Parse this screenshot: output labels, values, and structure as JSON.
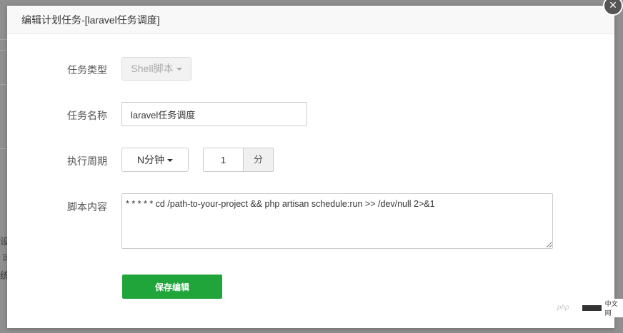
{
  "dialog": {
    "title": "编辑计划任务-[laravel任务调度]",
    "close_label": "×"
  },
  "form": {
    "task_type": {
      "label": "任务类型",
      "value": "Shell脚本"
    },
    "task_name": {
      "label": "任务名称",
      "value": "laravel任务调度"
    },
    "period": {
      "label": "执行周期",
      "value": "N分钟",
      "number": "1",
      "unit": "分"
    },
    "script": {
      "label": "脚本内容",
      "value": "* * * * * cd /path-to-your-project && php artisan schedule:run >> /dev/null 2>&1"
    },
    "save_label": "保存编辑"
  },
  "background": {
    "fragments": [
      "设是",
      "可",
      "统功"
    ]
  },
  "watermark": {
    "text": "php",
    "suffix": "中文网"
  },
  "colors": {
    "primary": "#20a53a",
    "overlay": "#8f8f8f"
  }
}
